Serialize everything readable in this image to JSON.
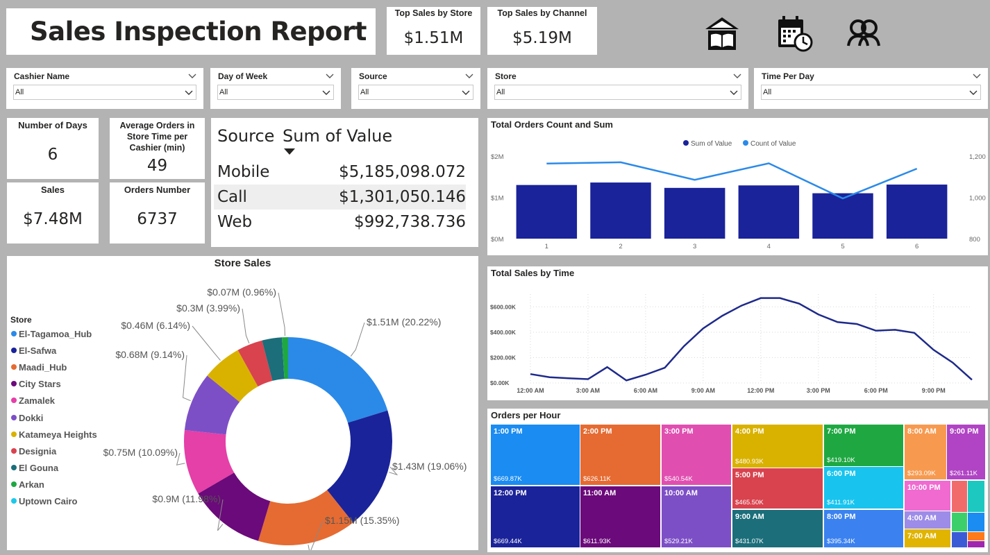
{
  "header": {
    "title": "Sales Inspection Report",
    "top_store_label": "Top Sales by Store",
    "top_store_value": "$1.51M",
    "top_channel_label": "Top Sales by Channel",
    "top_channel_value": "$5.19M",
    "nav_icons": [
      "home-book-icon",
      "calendar-clock-icon",
      "users-icon"
    ]
  },
  "slicers": [
    {
      "label": "Cashier Name",
      "value": "All"
    },
    {
      "label": "Day of Week",
      "value": "All"
    },
    {
      "label": "Source",
      "value": "All"
    },
    {
      "label": "Store",
      "value": "All"
    },
    {
      "label": "Time Per Day",
      "value": "All"
    }
  ],
  "kpis": {
    "days_label": "Number of Days",
    "days_value": "6",
    "avg_label": "Average Orders in Store Time per Cashier (min)",
    "avg_value": "49",
    "sales_label": "Sales",
    "sales_value": "$7.48M",
    "orders_label": "Orders Number",
    "orders_value": "6737"
  },
  "source_table": {
    "col1": "Source",
    "col2": "Sum of Value",
    "rows": [
      {
        "source": "Mobile",
        "value": "$5,185,098.072"
      },
      {
        "source": "Call",
        "value": "$1,301,050.146"
      },
      {
        "source": "Web",
        "value": "$992,738.736"
      }
    ]
  },
  "colors": {
    "navy": "#1a2399",
    "blue": "#2b8ae8",
    "line": "#1e2a8a"
  },
  "chart_data": [
    {
      "id": "orders_count_sum",
      "type": "bar",
      "title": "Total Orders Count and Sum",
      "categories": [
        "1",
        "2",
        "3",
        "4",
        "5",
        "6"
      ],
      "series": [
        {
          "name": "Sum of Value",
          "type": "bar",
          "values": [
            1.3,
            1.36,
            1.23,
            1.29,
            1.1,
            1.31
          ],
          "color": "#1a2399"
        },
        {
          "name": "Count of Value",
          "type": "line",
          "axis": "secondary",
          "values": [
            1164,
            1170,
            1085,
            1165,
            995,
            1139
          ],
          "color": "#2b8ae8"
        }
      ],
      "y_ticks": [
        "$0M",
        "$1M",
        "$2M"
      ],
      "ylim": [
        0,
        2
      ],
      "y2_ticks": [
        "800",
        "1,000",
        "1,200"
      ],
      "y2lim": [
        800,
        1200
      ],
      "legend_position": "top-center"
    },
    {
      "id": "sales_by_time",
      "type": "line",
      "title": "Total Sales by Time",
      "x": [
        "12:00 AM",
        "1:00 AM",
        "2:00 AM",
        "3:00 AM",
        "4:00 AM",
        "5:00 AM",
        "6:00 AM",
        "7:00 AM",
        "8:00 AM",
        "9:00 AM",
        "10:00 AM",
        "11:00 AM",
        "12:00 PM",
        "1:00 PM",
        "2:00 PM",
        "3:00 PM",
        "4:00 PM",
        "5:00 PM",
        "6:00 PM",
        "7:00 PM",
        "8:00 PM",
        "9:00 PM",
        "10:00 PM",
        "11:00 PM"
      ],
      "values": [
        70,
        45,
        37,
        30,
        125,
        20,
        65,
        120,
        290,
        430,
        530,
        610,
        669,
        669,
        625,
        540,
        480,
        465,
        412,
        419,
        395,
        261,
        160,
        25
      ],
      "y_unit": "K",
      "y_ticks": [
        "$0.00K",
        "$200.00K",
        "$400.00K",
        "$600.00K"
      ],
      "ylim": [
        0,
        700
      ],
      "x_tick_labels": [
        "12:00 AM",
        "3:00 AM",
        "6:00 AM",
        "9:00 AM",
        "12:00 PM",
        "3:00 PM",
        "6:00 PM",
        "9:00 PM"
      ],
      "color": "#1e2a8a"
    },
    {
      "id": "store_sales",
      "type": "pie",
      "title": "Store Sales",
      "legend_title": "Store",
      "legend_position": "left",
      "slices": [
        {
          "name": "El-Tagamoa_Hub",
          "value": 20.22,
          "label": "$1.51M (20.22%)",
          "color": "#2b8ae8"
        },
        {
          "name": "El-Safwa",
          "value": 19.06,
          "label": "$1.43M (19.06%)",
          "color": "#1a2399"
        },
        {
          "name": "Maadi_Hub",
          "value": 15.35,
          "label": "$1.15M (15.35%)",
          "color": "#e56b32"
        },
        {
          "name": "City Stars",
          "value": 11.98,
          "label": "$0.9M (11.98%)",
          "color": "#6b0a7a"
        },
        {
          "name": "Zamalek",
          "value": 10.09,
          "label": "$0.75M (10.09%)",
          "color": "#e53fa8"
        },
        {
          "name": "Dokki",
          "value": 9.14,
          "label": "$0.68M (9.14%)",
          "color": "#7d4fc6"
        },
        {
          "name": "Katameya Heights",
          "value": 6.14,
          "label": "$0.46M (6.14%)",
          "color": "#d9b200"
        },
        {
          "name": "Designia",
          "value": 3.99,
          "label": "$0.3M (3.99%)",
          "color": "#d8434e"
        },
        {
          "name": "El Gouna",
          "value": 3.07,
          "label": "",
          "color": "#1b6e7a"
        },
        {
          "name": "Arkan",
          "value": 0.96,
          "label": "$0.07M (0.96%)",
          "color": "#1fa842"
        },
        {
          "name": "Uptown Cairo",
          "value": 0.0,
          "label": "",
          "color": "#1dc8e8"
        }
      ]
    },
    {
      "id": "orders_per_hour",
      "type": "treemap",
      "title": "Orders per Hour",
      "cells": [
        {
          "label": "1:00 PM",
          "value": "$669.87K",
          "color": "#1a8cf2"
        },
        {
          "label": "12:00 PM",
          "value": "$669.44K",
          "color": "#1a2399"
        },
        {
          "label": "2:00 PM",
          "value": "$626.11K",
          "color": "#e56b32"
        },
        {
          "label": "11:00 AM",
          "value": "$611.93K",
          "color": "#6b0a7a"
        },
        {
          "label": "3:00 PM",
          "value": "$540.54K",
          "color": "#e04fb0"
        },
        {
          "label": "10:00 AM",
          "value": "$529.21K",
          "color": "#7d4fc6"
        },
        {
          "label": "4:00 PM",
          "value": "$480.93K",
          "color": "#d9b200"
        },
        {
          "label": "5:00 PM",
          "value": "$465.50K",
          "color": "#d8434e"
        },
        {
          "label": "9:00 AM",
          "value": "$431.07K",
          "color": "#1b6e7a"
        },
        {
          "label": "7:00 PM",
          "value": "$419.10K",
          "color": "#1fa842"
        },
        {
          "label": "6:00 PM",
          "value": "$411.91K",
          "color": "#18c4ee"
        },
        {
          "label": "8:00 PM",
          "value": "$395.34K",
          "color": "#3b82f0"
        },
        {
          "label": "8:00 AM",
          "value": "$293.09K",
          "color": "#f79a4f"
        },
        {
          "label": "9:00 PM",
          "value": "$261.11K",
          "color": "#b044c4"
        },
        {
          "label": "10:00 PM",
          "value": "",
          "color": "#f06ad0"
        },
        {
          "label": "4:00 AM",
          "value": "",
          "color": "#9d8ce8"
        },
        {
          "label": "7:00 AM",
          "value": "",
          "color": "#e0b400"
        }
      ]
    }
  ]
}
